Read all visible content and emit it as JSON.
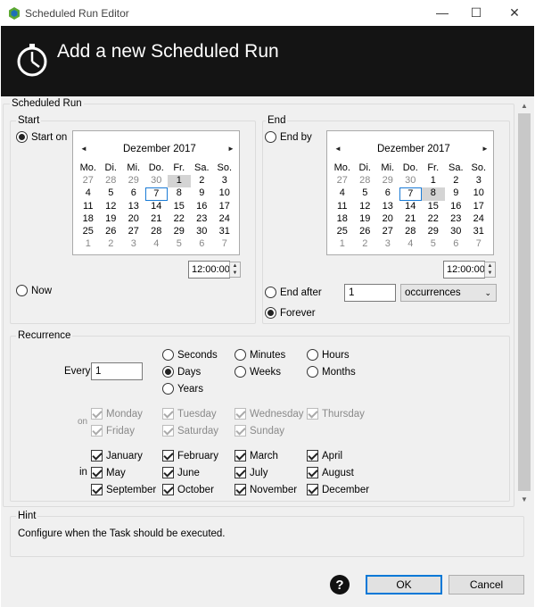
{
  "window": {
    "title": "Scheduled Run Editor",
    "minimize": "—",
    "maximize": "☐",
    "close": "✕"
  },
  "header": {
    "title": "Add a new Scheduled Run"
  },
  "section_title": "Scheduled Run",
  "start": {
    "group_label": "Start",
    "start_on_label": "Start on",
    "now_label": "Now",
    "selected": "start_on",
    "calendar": {
      "month_label": "Dezember 2017",
      "prev": "◄",
      "next": "►",
      "weekdays": [
        "Mo.",
        "Di.",
        "Mi.",
        "Do.",
        "Fr.",
        "Sa.",
        "So."
      ],
      "days": [
        "27",
        "28",
        "29",
        "30",
        "1",
        "2",
        "3",
        "4",
        "5",
        "6",
        "7",
        "8",
        "9",
        "10",
        "11",
        "12",
        "13",
        "14",
        "15",
        "16",
        "17",
        "18",
        "19",
        "20",
        "21",
        "22",
        "23",
        "24",
        "25",
        "26",
        "27",
        "28",
        "29",
        "30",
        "31",
        "1",
        "2",
        "3",
        "4",
        "5",
        "6",
        "7"
      ],
      "selected_day": "1",
      "today_day": "7"
    },
    "time": "12:00:00"
  },
  "end": {
    "group_label": "End",
    "end_by_label": "End by",
    "end_after_label": "End after",
    "forever_label": "Forever",
    "selected": "forever",
    "calendar": {
      "month_label": "Dezember 2017",
      "prev": "◄",
      "next": "►",
      "weekdays": [
        "Mo.",
        "Di.",
        "Mi.",
        "Do.",
        "Fr.",
        "Sa.",
        "So."
      ],
      "days": [
        "27",
        "28",
        "29",
        "30",
        "1",
        "2",
        "3",
        "4",
        "5",
        "6",
        "7",
        "8",
        "9",
        "10",
        "11",
        "12",
        "13",
        "14",
        "15",
        "16",
        "17",
        "18",
        "19",
        "20",
        "21",
        "22",
        "23",
        "24",
        "25",
        "26",
        "27",
        "28",
        "29",
        "30",
        "31",
        "1",
        "2",
        "3",
        "4",
        "5",
        "6",
        "7"
      ],
      "selected_day": "8",
      "today_day": "7"
    },
    "time": "12:00:00",
    "end_after_value": "1",
    "end_after_unit": "occurrences"
  },
  "recurrence": {
    "group_label": "Recurrence",
    "every_label": "Every",
    "every_value": "1",
    "units": [
      "Seconds",
      "Minutes",
      "Hours",
      "Days",
      "Weeks",
      "Months",
      "Years"
    ],
    "selected_unit": "Days",
    "on_label": "on",
    "weekdays": [
      {
        "label": "Monday",
        "checked": true
      },
      {
        "label": "Tuesday",
        "checked": true
      },
      {
        "label": "Wednesday",
        "checked": true
      },
      {
        "label": "Thursday",
        "checked": true
      },
      {
        "label": "Friday",
        "checked": true
      },
      {
        "label": "Saturday",
        "checked": true
      },
      {
        "label": "Sunday",
        "checked": true
      }
    ],
    "in_label": "in",
    "months": [
      {
        "label": "January",
        "checked": true
      },
      {
        "label": "February",
        "checked": true
      },
      {
        "label": "March",
        "checked": true
      },
      {
        "label": "April",
        "checked": true
      },
      {
        "label": "May",
        "checked": true
      },
      {
        "label": "June",
        "checked": true
      },
      {
        "label": "July",
        "checked": true
      },
      {
        "label": "August",
        "checked": true
      },
      {
        "label": "September",
        "checked": true
      },
      {
        "label": "October",
        "checked": true
      },
      {
        "label": "November",
        "checked": true
      },
      {
        "label": "December",
        "checked": true
      }
    ]
  },
  "hint": {
    "group_label": "Hint",
    "text": "Configure when the Task should be executed."
  },
  "footer": {
    "help_icon": "?",
    "ok_label": "OK",
    "cancel_label": "Cancel"
  },
  "colors": {
    "header_bg": "#141414",
    "accent": "#0078d7",
    "dialog_bg": "#f0f0f0"
  },
  "icons": {
    "app": "app-logo-icon",
    "header": "stopwatch-icon",
    "help": "help-icon"
  }
}
